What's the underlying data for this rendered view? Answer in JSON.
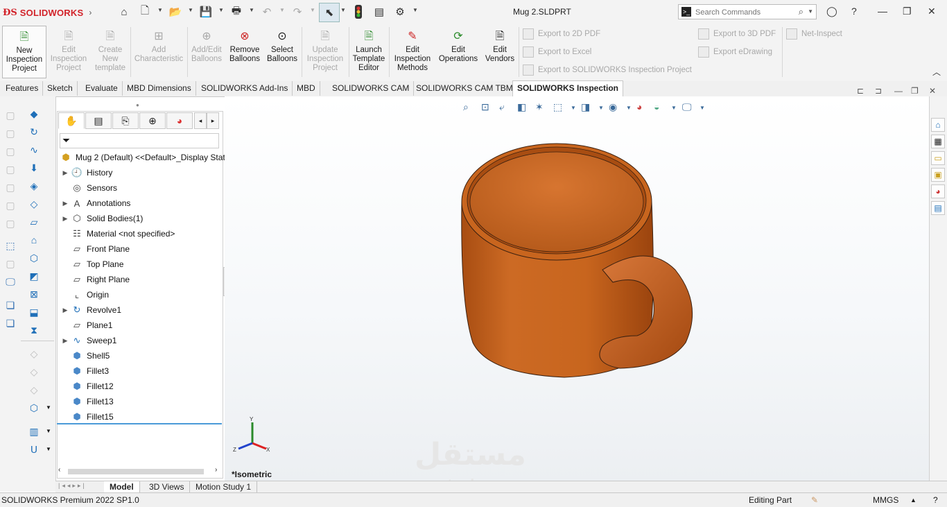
{
  "app": {
    "brand": "SOLIDWORKS",
    "doc_title": "Mug 2.SLDPRT"
  },
  "search": {
    "placeholder": "Search Commands"
  },
  "commands": {
    "new_inspection": "New Inspection Project",
    "edit_inspection": "Edit Inspection Project",
    "create_template": "Create New template",
    "add_characteristic": "Add Characteristic",
    "add_edit_balloons": "Add/Edit Balloons",
    "remove_balloons": "Remove Balloons",
    "select_balloons": "Select Balloons",
    "update_inspection": "Update Inspection Project",
    "launch_template_editor": "Launch Template Editor",
    "edit_inspection_methods": "Edit Inspection Methods",
    "edit_operations": "Edit Operations",
    "edit_vendors": "Edit Vendors",
    "export_2d_pdf": "Export to 2D PDF",
    "export_excel": "Export to Excel",
    "export_sw_inspection": "Export to SOLIDWORKS Inspection Project",
    "export_3d_pdf": "Export to 3D PDF",
    "export_edrawing": "Export eDrawing",
    "net_inspect": "Net-Inspect"
  },
  "tabs": [
    "Features",
    "Sketch",
    "Evaluate",
    "MBD Dimensions",
    "SOLIDWORKS Add-Ins",
    "MBD",
    "SOLIDWORKS CAM",
    "SOLIDWORKS CAM TBM",
    "SOLIDWORKS Inspection"
  ],
  "active_tab": "SOLIDWORKS Inspection",
  "tree": {
    "root": "Mug 2 (Default) <<Default>_Display Stat",
    "items": [
      {
        "label": "History",
        "icon": "history-icon",
        "expandable": true
      },
      {
        "label": "Sensors",
        "icon": "sensors-icon",
        "expandable": false
      },
      {
        "label": "Annotations",
        "icon": "annotations-icon",
        "expandable": true
      },
      {
        "label": "Solid Bodies(1)",
        "icon": "solid-bodies-icon",
        "expandable": true
      },
      {
        "label": "Material <not specified>",
        "icon": "material-icon",
        "expandable": false
      },
      {
        "label": "Front Plane",
        "icon": "plane-icon",
        "expandable": false
      },
      {
        "label": "Top Plane",
        "icon": "plane-icon",
        "expandable": false
      },
      {
        "label": "Right Plane",
        "icon": "plane-icon",
        "expandable": false
      },
      {
        "label": "Origin",
        "icon": "origin-icon",
        "expandable": false
      },
      {
        "label": "Revolve1",
        "icon": "revolve-icon",
        "expandable": true
      },
      {
        "label": "Plane1",
        "icon": "plane-icon",
        "expandable": false
      },
      {
        "label": "Sweep1",
        "icon": "sweep-icon",
        "expandable": true
      },
      {
        "label": "Shell5",
        "icon": "shell-icon",
        "expandable": false
      },
      {
        "label": "Fillet3",
        "icon": "fillet-icon",
        "expandable": false
      },
      {
        "label": "Fillet12",
        "icon": "fillet-icon",
        "expandable": false
      },
      {
        "label": "Fillet13",
        "icon": "fillet-icon",
        "expandable": false
      },
      {
        "label": "Fillet15",
        "icon": "fillet-icon",
        "expandable": false
      }
    ]
  },
  "viewport": {
    "view_label": "*Isometric",
    "triad": {
      "x": "X",
      "y": "Y",
      "z": "Z"
    },
    "model_color": "#c8651e",
    "watermark": "مستقل",
    "watermark_url": "mostaql.com"
  },
  "bottom_tabs": [
    "Model",
    "3D Views",
    "Motion Study 1"
  ],
  "active_bottom_tab": "Model",
  "status": {
    "product": "SOLIDWORKS Premium 2022 SP1.0",
    "mode": "Editing Part",
    "units": "MMGS"
  }
}
